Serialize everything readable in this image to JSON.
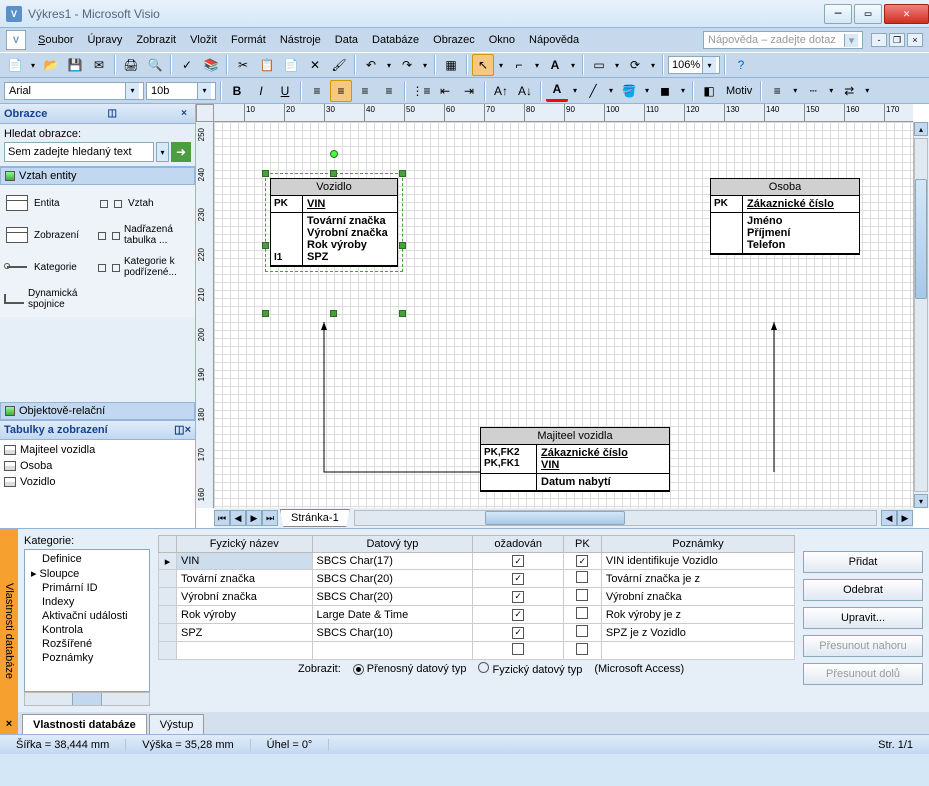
{
  "window": {
    "title": "Výkres1 - Microsoft Visio"
  },
  "menu": {
    "file": "Soubor",
    "edit": "Úpravy",
    "view": "Zobrazit",
    "insert": "Vložit",
    "format": "Formát",
    "tools": "Nástroje",
    "data": "Data",
    "database": "Databáze",
    "shape": "Obrazec",
    "window": "Okno",
    "help": "Nápověda",
    "help_placeholder": "Nápověda – zadejte dotaz"
  },
  "toolbar": {
    "zoom": "106%",
    "font": "Arial",
    "size": "10b",
    "motiv": "Motiv"
  },
  "shapes_panel": {
    "title": "Obrazce",
    "search_label": "Hledat obrazce:",
    "search_placeholder": "Sem zadejte hledaný text",
    "cat1": "Vztah entity",
    "items1": [
      "Entita",
      "Vztah",
      "Zobrazení",
      "Nadřazená tabulka ...",
      "Kategorie",
      "Kategorie k podřízené...",
      "Dynamická spojnice"
    ],
    "cat2": "Objektově-relační"
  },
  "tables_panel": {
    "title": "Tabulky a zobrazení",
    "items": [
      "Majiteel vozidla",
      "Osoba",
      "Vozidlo"
    ]
  },
  "canvas": {
    "page_tab": "Stránka-1",
    "vozidlo": {
      "title": "Vozidlo",
      "pk_lbl": "PK",
      "pk_val": "VIN",
      "i_lbl": "I1",
      "attrs": "Tovární značka\nVýrobní značka\nRok výroby\nSPZ"
    },
    "osoba": {
      "title": "Osoba",
      "pk_lbl": "PK",
      "pk_val": "Zákaznické číslo",
      "attrs": "Jméno\nPříjmení\nTelefon"
    },
    "majitel": {
      "title": "Majiteel vozidla",
      "k1": "PK,FK2",
      "v1": "Zákaznické číslo",
      "k2": "PK,FK1",
      "v2": "VIN",
      "attr": "Datum nabytí"
    }
  },
  "db_panel": {
    "tab_title": "Vlastnosti databáze",
    "kategorie_lbl": "Kategorie:",
    "kategorie": [
      "Definice",
      "Sloupce",
      "Primární ID",
      "Indexy",
      "Aktivační události",
      "Kontrola",
      "Rozšířené",
      "Poznámky"
    ],
    "headers": {
      "phys": "Fyzický název",
      "dtype": "Datový typ",
      "req": "ožadován",
      "pk": "PK",
      "notes": "Poznámky"
    },
    "rows": [
      {
        "name": "VIN",
        "type": "SBCS Char(17)",
        "req": true,
        "pk": true,
        "note": "VIN identifikuje Vozidlo"
      },
      {
        "name": "Tovární značka",
        "type": "SBCS Char(20)",
        "req": true,
        "pk": false,
        "note": "Tovární značka je z"
      },
      {
        "name": "Výrobní značka",
        "type": "SBCS Char(20)",
        "req": true,
        "pk": false,
        "note": "Výrobní značka"
      },
      {
        "name": "Rok výroby",
        "type": "Large Date & Time",
        "req": true,
        "pk": false,
        "note": "Rok výroby je z"
      },
      {
        "name": "SPZ",
        "type": "SBCS Char(10)",
        "req": true,
        "pk": false,
        "note": "SPZ je z Vozidlo"
      }
    ],
    "buttons": {
      "add": "Přidat",
      "remove": "Odebrat",
      "edit": "Upravit...",
      "up": "Přesunout nahoru",
      "down": "Přesunout dolů"
    },
    "show_label": "Zobrazit:",
    "radio1": "Přenosný datový typ",
    "radio2": "Fyzický datový typ",
    "dbms": "(Microsoft Access)",
    "tab1": "Vlastnosti databáze",
    "tab2": "Výstup"
  },
  "status": {
    "width": "Šířka = 38,444 mm",
    "height": "Výška = 35,28 mm",
    "angle": "Úhel = 0°",
    "page": "Str. 1/1"
  }
}
